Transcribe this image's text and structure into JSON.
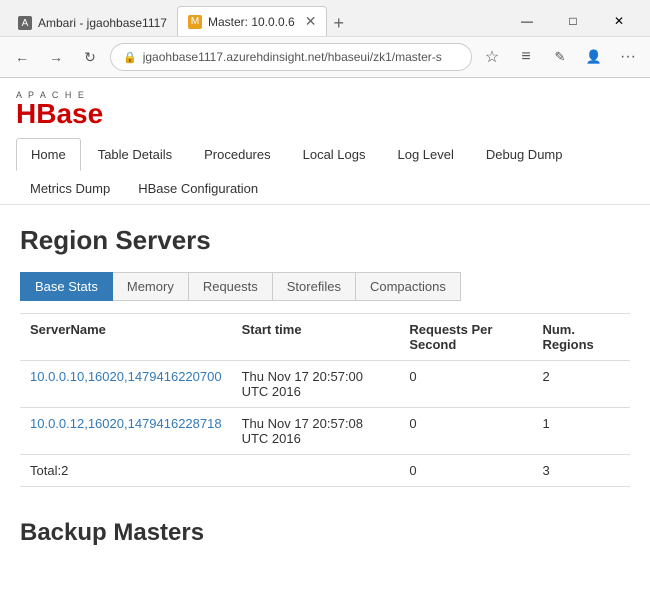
{
  "browser": {
    "tabs": [
      {
        "id": "ambari",
        "label": "Ambari - jgaohbase1117",
        "active": false,
        "icon": "A"
      },
      {
        "id": "master",
        "label": "Master: 10.0.0.6",
        "active": true,
        "icon": "M"
      }
    ],
    "address": "jgaohbase1117.azurehdinsight.net/hbaseui/zk1/master-s",
    "nav": {
      "back": "←",
      "forward": "→",
      "refresh": "↻",
      "lock_icon": "🔒"
    },
    "window_controls": {
      "minimize": "—",
      "maximize": "□",
      "close": "✕"
    }
  },
  "nav": {
    "tabs_row1": [
      {
        "id": "home",
        "label": "Home",
        "active": true
      },
      {
        "id": "table-details",
        "label": "Table Details",
        "active": false
      },
      {
        "id": "procedures",
        "label": "Procedures",
        "active": false
      },
      {
        "id": "local-logs",
        "label": "Local Logs",
        "active": false
      },
      {
        "id": "log-level",
        "label": "Log Level",
        "active": false
      },
      {
        "id": "debug-dump",
        "label": "Debug Dump",
        "active": false
      }
    ],
    "tabs_row2": [
      {
        "id": "metrics-dump",
        "label": "Metrics Dump"
      },
      {
        "id": "hbase-config",
        "label": "HBase Configuration"
      }
    ]
  },
  "region_servers": {
    "title": "Region Servers",
    "sub_tabs": [
      {
        "id": "base-stats",
        "label": "Base Stats",
        "active": true
      },
      {
        "id": "memory",
        "label": "Memory",
        "active": false
      },
      {
        "id": "requests",
        "label": "Requests",
        "active": false
      },
      {
        "id": "storefiles",
        "label": "Storefiles",
        "active": false
      },
      {
        "id": "compactions",
        "label": "Compactions",
        "active": false
      }
    ],
    "table": {
      "headers": [
        "ServerName",
        "Start time",
        "Requests Per Second",
        "Num. Regions"
      ],
      "rows": [
        {
          "server_name": "10.0.0.10,16020,1479416220700",
          "start_time": "Thu Nov 17 20:57:00 UTC 2016",
          "requests_per_second": "0",
          "num_regions": "2"
        },
        {
          "server_name": "10.0.0.12,16020,1479416228718",
          "start_time": "Thu Nov 17 20:57:08 UTC 2016",
          "requests_per_second": "0",
          "num_regions": "1"
        }
      ],
      "total_row": {
        "label": "Total:2",
        "requests_per_second": "0",
        "num_regions": "3"
      }
    }
  },
  "backup_masters": {
    "title": "Backup Masters"
  }
}
